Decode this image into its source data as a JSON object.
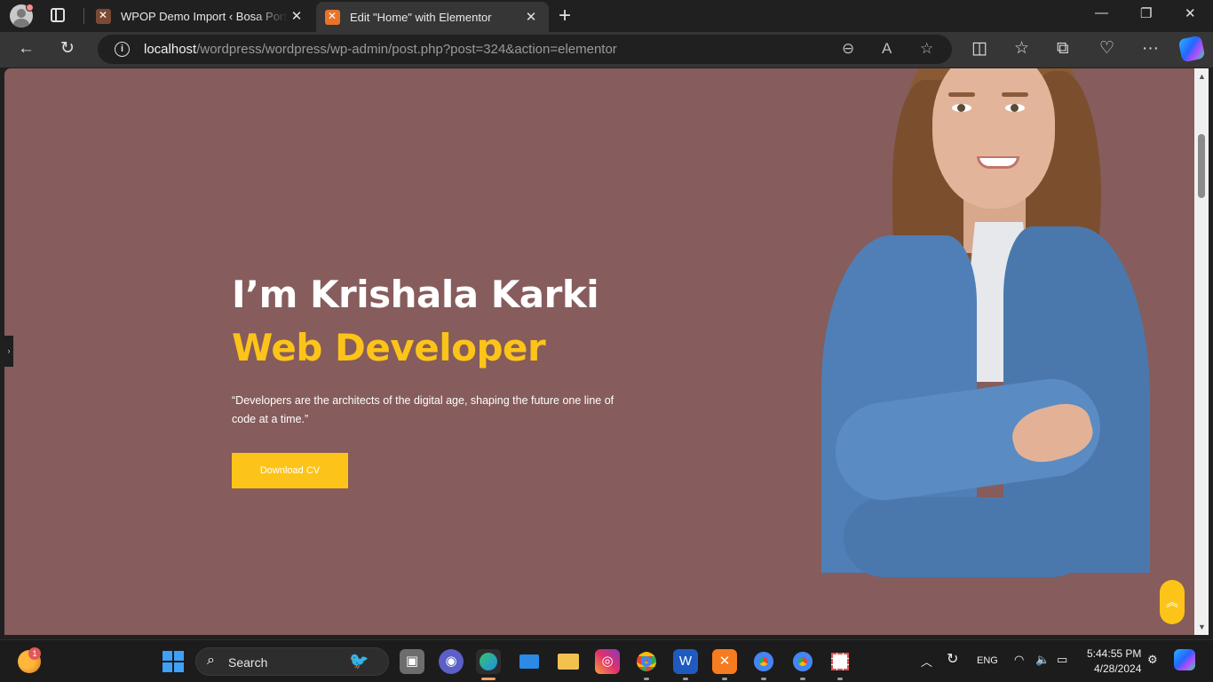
{
  "browser": {
    "tabs": [
      {
        "title": "WPOP Demo Import ‹ Bosa Portfolio",
        "active": false
      },
      {
        "title": "Edit \"Home\" with Elementor",
        "active": true
      }
    ],
    "address": {
      "host": "localhost",
      "path": "/wordpress/wordpress/wp-admin/post.php?post=324&action=elementor"
    }
  },
  "hero": {
    "name": "I’m Krishala Karki",
    "role": "Web Developer",
    "quote": "“Developers are the architects of the digital age, shaping the future one line of code at a time.”",
    "button": "Download CV",
    "colors": {
      "background": "#865c5c",
      "accent": "#fcc419"
    }
  },
  "taskbar": {
    "weather_badge": "1",
    "search_label": "Search",
    "language": "ENG",
    "time": "5:44:55 PM",
    "date": "4/28/2024"
  }
}
